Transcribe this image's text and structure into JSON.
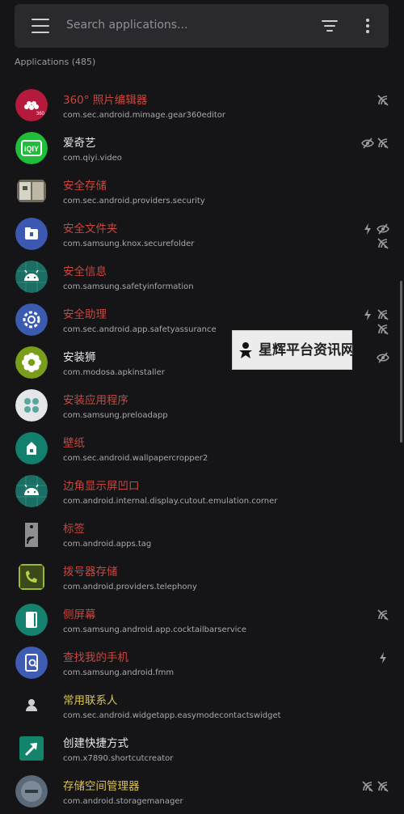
{
  "search": {
    "placeholder": "Search applications..."
  },
  "section": {
    "title": "Applications (485)"
  },
  "apps": [
    {
      "name": "360° 照片编辑器",
      "package": "com.sec.android.mimage.gear360editor",
      "name_color": "red",
      "icon": "gear360-icon",
      "flags": [
        "no-internet-icon"
      ]
    },
    {
      "name": "爱奇艺",
      "package": "com.qiyi.video",
      "name_color": "normal",
      "icon": "iqiyi-icon",
      "flags": [
        "hidden-icon",
        "no-internet-icon"
      ]
    },
    {
      "name": "安全存储",
      "package": "com.sec.android.providers.security",
      "name_color": "red",
      "icon": "security-storage-icon",
      "flags": []
    },
    {
      "name": "安全文件夹",
      "package": "com.samsung.knox.securefolder",
      "name_color": "red",
      "icon": "secure-folder-icon",
      "flags": [
        "bolt-icon",
        "hidden-icon",
        "no-internet-icon"
      ]
    },
    {
      "name": "安全信息",
      "package": "com.samsung.safetyinformation",
      "name_color": "red",
      "icon": "android-icon",
      "flags": []
    },
    {
      "name": "安全助理",
      "package": "com.sec.android.app.safetyassurance",
      "name_color": "red",
      "icon": "settings-gear-icon",
      "flags": [
        "bolt-icon",
        "no-internet-icon",
        "no-internet-icon"
      ]
    },
    {
      "name": "安装狮",
      "package": "com.modosa.apkinstaller",
      "name_color": "normal",
      "icon": "flower-icon",
      "flags": [
        "hidden-icon"
      ]
    },
    {
      "name": "安装应用程序",
      "package": "com.samsung.preloadapp",
      "name_color": "red",
      "icon": "preload-app-icon",
      "flags": []
    },
    {
      "name": "壁纸",
      "package": "com.sec.android.wallpapercropper2",
      "name_color": "red",
      "icon": "wallpaper-icon",
      "flags": []
    },
    {
      "name": "边角显示屏凹口",
      "package": "com.android.internal.display.cutout.emulation.corner",
      "name_color": "red",
      "icon": "android-icon",
      "flags": []
    },
    {
      "name": "标签",
      "package": "com.android.apps.tag",
      "name_color": "red",
      "icon": "nfc-tag-icon",
      "flags": []
    },
    {
      "name": "拨号器存储",
      "package": "com.android.providers.telephony",
      "name_color": "red",
      "icon": "phone-icon",
      "flags": []
    },
    {
      "name": "侧屏幕",
      "package": "com.samsung.android.app.cocktailbarservice",
      "name_color": "red",
      "icon": "edge-screen-icon",
      "flags": [
        "no-internet-icon"
      ]
    },
    {
      "name": "查找我的手机",
      "package": "com.samsung.android.fmm",
      "name_color": "red",
      "icon": "find-phone-icon",
      "flags": [
        "bolt-icon"
      ]
    },
    {
      "name": "常用联系人",
      "package": "com.sec.android.widgetapp.easymodecontactswidget",
      "name_color": "yellow",
      "icon": "contact-person-icon",
      "flags": []
    },
    {
      "name": "创建快捷方式",
      "package": "com.x7890.shortcutcreator",
      "name_color": "normal",
      "icon": "shortcut-arrow-icon",
      "flags": []
    },
    {
      "name": "存储空间管理器",
      "package": "com.android.storagemanager",
      "name_color": "yellow",
      "icon": "storage-manager-icon",
      "flags": [
        "no-internet-icon",
        "no-internet-icon"
      ]
    }
  ],
  "watermark": {
    "text": "星辉平台资讯网"
  },
  "colors": {
    "background": "#151518",
    "searchbar": "#2a2a2e",
    "name_red": "#c8463e",
    "name_yellow": "#d8c254",
    "name_normal": "#e8e8e8"
  },
  "icons": {
    "menu": "hamburger-menu-icon",
    "filter": "filter-icon",
    "more": "more-vertical-icon"
  }
}
